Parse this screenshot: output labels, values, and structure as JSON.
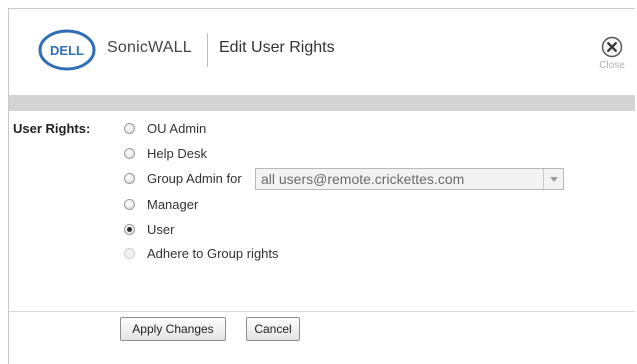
{
  "header": {
    "logo_text": "DELL",
    "brand": "SonicWALL",
    "title": "Edit User Rights",
    "close_label": "Close"
  },
  "form": {
    "label": "User Rights:",
    "options": [
      {
        "label": "OU Admin",
        "checked": false,
        "disabled": false
      },
      {
        "label": "Help Desk",
        "checked": false,
        "disabled": false
      },
      {
        "label": "Group Admin for",
        "checked": false,
        "disabled": false
      },
      {
        "label": "Manager",
        "checked": false,
        "disabled": false
      },
      {
        "label": "User",
        "checked": true,
        "disabled": false
      },
      {
        "label": "Adhere to Group rights",
        "checked": false,
        "disabled": true
      }
    ],
    "group_select_value": "all users@remote.crickettes.com"
  },
  "buttons": {
    "apply": "Apply Changes",
    "cancel": "Cancel"
  },
  "colors": {
    "dell_blue": "#2f6fb7",
    "band_gray": "#d3d3d3"
  },
  "icons": {
    "close": "close-icon",
    "logo": "dell-logo"
  }
}
